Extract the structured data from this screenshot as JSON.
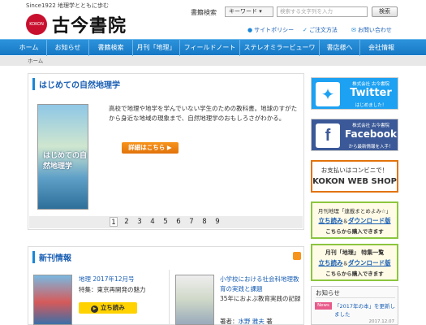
{
  "header": {
    "tagline": "Since1922  地理学とともに歩む",
    "logo_badge": "KOKON",
    "logo_name": "古今書院",
    "search_label": "書籍検索",
    "search_select": "キーワード",
    "search_placeholder": "検索する文字列を入力",
    "search_button": "検索",
    "links": [
      "サイトポリシー",
      "ご注文方法",
      "お問い合わせ"
    ]
  },
  "nav": [
    "ホーム",
    "お知らせ",
    "書籍検索",
    "月刊「地理」",
    "フィールドノート",
    "ステレオミラービューワ",
    "書店様へ",
    "会社情報"
  ],
  "breadcrumb": "ホーム",
  "feature": {
    "title": "はじめての自然地理学",
    "book_title": "はじめての自然地理学",
    "description": "高校で地理や地学を学んでいない学生のための教科書。地球のすがたから身近な地域の現象まで、自然地理学のおもしろさがわかる。",
    "detail_button": "詳細はこちら",
    "pages": [
      "1",
      "2",
      "3",
      "4",
      "5",
      "6",
      "7",
      "8",
      "9"
    ]
  },
  "new_books": {
    "title": "新刊情報",
    "items": [
      {
        "title": "地理 2017年12月号",
        "sub": "特集：東京再開発の魅力",
        "button": "立ち読み"
      },
      {
        "title": "小学校における社会科地理教育の実践と課題",
        "sub": "35年におよぶ教育実践の記録",
        "author_label": "著者：",
        "author": "水野 雅夫",
        "author_suffix": "著"
      }
    ]
  },
  "sidebar": {
    "twitter_top": "株式会社 古今書院",
    "twitter_name": "Twitter",
    "twitter_sub": "はじめました！",
    "fb_top": "株式会社 古今書院",
    "fb_name": "Facebook",
    "fb_sub": "から最新情報を入手！",
    "kokon_top": "お支払いはコンビニで！",
    "kokon_name": "KOKON WEB SHOP",
    "ad1_title": "月刊地理「連載まとめよみ☆」",
    "ad1_link1": "立ち読み",
    "ad1_amp": "＆",
    "ad1_link2": "ダウンロード版",
    "ad1_buy": "こちらから購入できます",
    "ad2_title": "月刊「地理」 特集一覧",
    "ad2_link1": "立ち読み",
    "ad2_amp": "＆",
    "ad2_link2": "ダウンロード版",
    "ad2_buy": "こちらから購入できます",
    "news_title": "お知らせ",
    "news_badge": "News",
    "news_text": "「2017年の本」を更新しました",
    "news_date": "2017.12.07"
  },
  "colors": {
    "nav": "#1678c4",
    "accent": "#f7941d",
    "link": "#1a5fb4"
  }
}
